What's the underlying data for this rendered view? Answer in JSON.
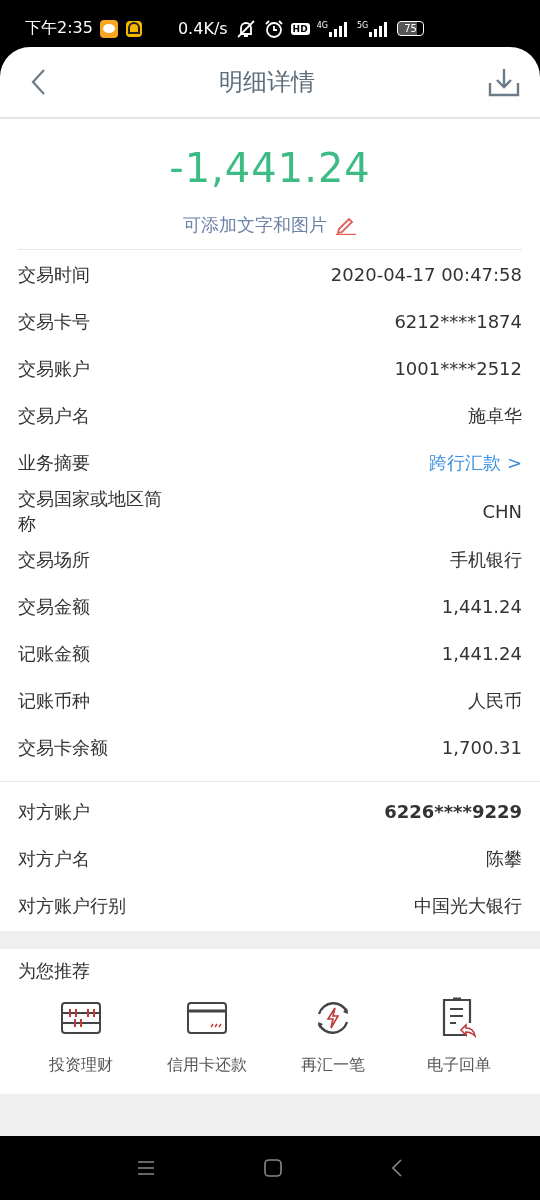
{
  "status_bar": {
    "time": "下午2:35",
    "speed": "0.4K/s",
    "hd": "HD",
    "network_1": "4G",
    "network_2": "5G",
    "battery": "75"
  },
  "header": {
    "title": "明细详情"
  },
  "amount": "-1,441.24",
  "note_link": "可添加文字和图片",
  "details": [
    {
      "label": "交易时间",
      "value": "2020-04-17 00:47:58",
      "kind": "plain"
    },
    {
      "label": "交易卡号",
      "value": "6212****1874",
      "kind": "plain"
    },
    {
      "label": "交易账户",
      "value": "1001****2512",
      "kind": "plain"
    },
    {
      "label": "交易户名",
      "value": "施卓华",
      "kind": "plain"
    },
    {
      "label": "业务摘要",
      "value": "跨行汇款 >",
      "kind": "link"
    },
    {
      "label": "交易国家或地区简称",
      "value": "CHN",
      "kind": "plain"
    },
    {
      "label": "交易场所",
      "value": "手机银行",
      "kind": "plain"
    },
    {
      "label": "交易金额",
      "value": "1,441.24",
      "kind": "plain"
    },
    {
      "label": "记账金额",
      "value": "1,441.24",
      "kind": "plain"
    },
    {
      "label": "记账币种",
      "value": "人民币",
      "kind": "plain"
    },
    {
      "label": "交易卡余额",
      "value": "1,700.31",
      "kind": "plain"
    }
  ],
  "counterparty": [
    {
      "label": "对方账户",
      "value": "6226****9229",
      "kind": "bold"
    },
    {
      "label": "对方户名",
      "value": "陈攀",
      "kind": "plain"
    },
    {
      "label": "对方账户行别",
      "value": "中国光大银行",
      "kind": "plain"
    }
  ],
  "recommend": {
    "title": "为您推荐",
    "items": [
      {
        "label": "投资理财",
        "kind": "abacus"
      },
      {
        "label": "信用卡还款",
        "kind": "card"
      },
      {
        "label": "再汇一笔",
        "kind": "repeat"
      },
      {
        "label": "电子回单",
        "kind": "receipt"
      }
    ]
  }
}
